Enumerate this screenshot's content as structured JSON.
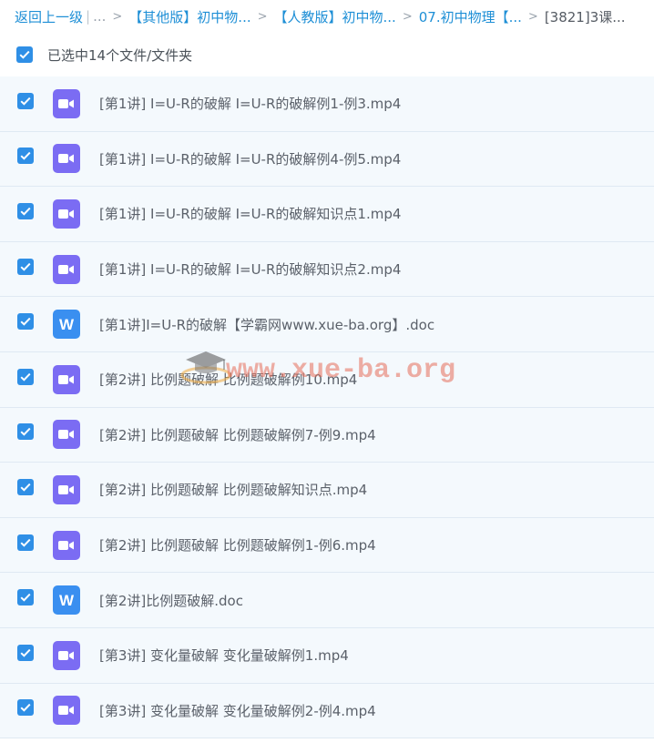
{
  "breadcrumb": {
    "back": "返回上一级",
    "bar": "|",
    "ellipsis": "...",
    "sep": ">",
    "items": [
      "【其他版】初中物...",
      "【人教版】初中物...",
      "07.初中物理【..."
    ],
    "current": "[3821]3课..."
  },
  "selection": {
    "label": "已选中14个文件/文件夹"
  },
  "files": [
    {
      "name": "[第1讲] I=U-R的破解 I=U-R的破解例1-例3.mp4",
      "type": "video"
    },
    {
      "name": "[第1讲] I=U-R的破解 I=U-R的破解例4-例5.mp4",
      "type": "video"
    },
    {
      "name": "[第1讲] I=U-R的破解 I=U-R的破解知识点1.mp4",
      "type": "video"
    },
    {
      "name": "[第1讲] I=U-R的破解 I=U-R的破解知识点2.mp4",
      "type": "video"
    },
    {
      "name": "[第1讲]I=U-R的破解【学霸网www.xue-ba.org】.doc",
      "type": "doc"
    },
    {
      "name": "[第2讲] 比例题破解 比例题破解例10.mp4",
      "type": "video"
    },
    {
      "name": "[第2讲] 比例题破解 比例题破解例7-例9.mp4",
      "type": "video"
    },
    {
      "name": "[第2讲] 比例题破解 比例题破解知识点.mp4",
      "type": "video"
    },
    {
      "name": "[第2讲] 比例题破解 比例题破解例1-例6.mp4",
      "type": "video"
    },
    {
      "name": "[第2讲]比例题破解.doc",
      "type": "doc"
    },
    {
      "name": "[第3讲] 变化量破解 变化量破解例1.mp4",
      "type": "video"
    },
    {
      "name": "[第3讲] 变化量破解 变化量破解例2-例4.mp4",
      "type": "video"
    }
  ],
  "doc_icon_letter": "W",
  "watermark": {
    "text": "www.xue-ba.org"
  },
  "colors": {
    "link": "#1e8fd6",
    "checkbox": "#2f8fe6",
    "video_icon": "#7b6cf3",
    "doc_icon": "#3a8ff0",
    "row_bg": "#f4f9fd",
    "row_border": "#dfe9f3",
    "watermark": "#e66e5a"
  }
}
